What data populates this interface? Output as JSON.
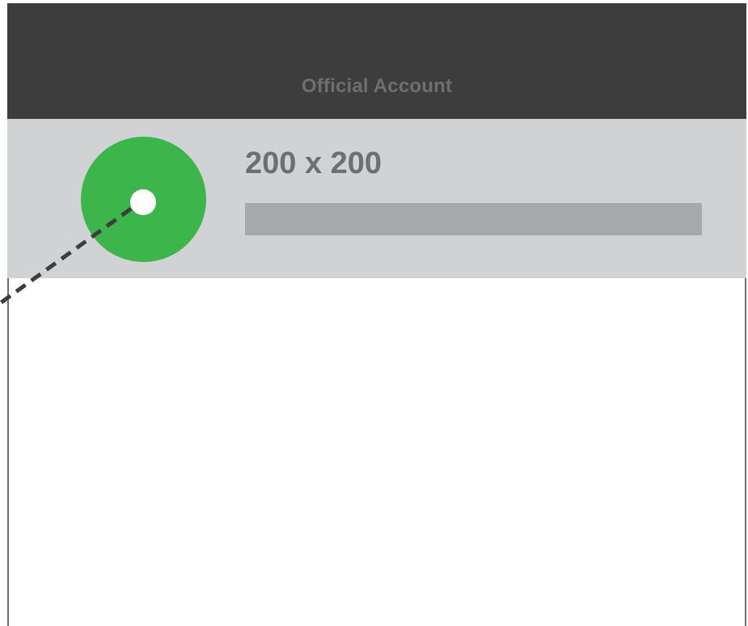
{
  "header": {
    "title": "Official Account"
  },
  "profile": {
    "avatar_size_label": "200 x 200",
    "avatar_color": "#3cb54a",
    "name_placeholder_color": "#a7a8ab"
  },
  "colors": {
    "header_bg": "#3d3d3d",
    "card_bg": "#d1d2d4",
    "title_text": "#6f6f6f",
    "label_text": "#6e6f71"
  }
}
